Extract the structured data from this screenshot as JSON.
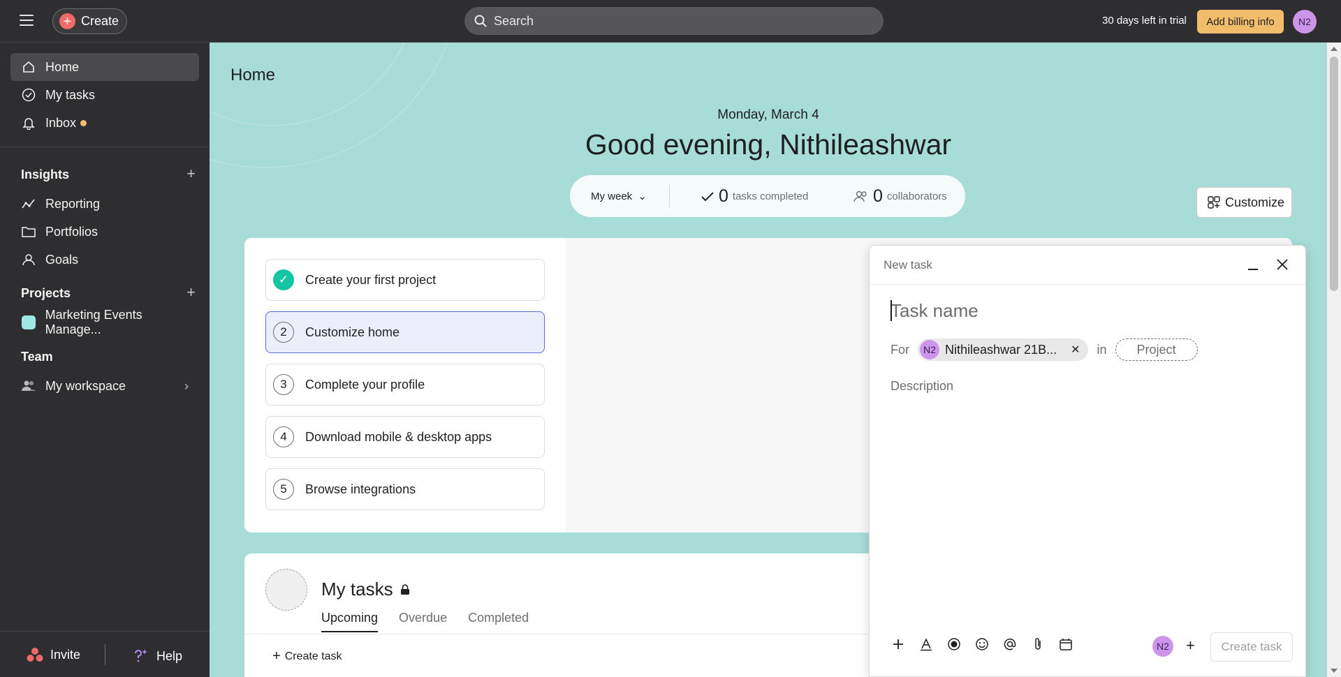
{
  "topbar": {
    "create_label": "Create",
    "search_placeholder": "Search",
    "trial_text": "30 days left in trial",
    "billing_label": "Add billing info",
    "user_initials": "N2"
  },
  "sidebar": {
    "nav": [
      {
        "label": "Home",
        "icon": "home-icon"
      },
      {
        "label": "My tasks",
        "icon": "check-circle-icon"
      },
      {
        "label": "Inbox",
        "icon": "bell-icon"
      }
    ],
    "insights": {
      "title": "Insights",
      "items": [
        {
          "label": "Reporting",
          "icon": "chart-line-icon"
        },
        {
          "label": "Portfolios",
          "icon": "folder-icon"
        },
        {
          "label": "Goals",
          "icon": "person-icon"
        }
      ]
    },
    "projects": {
      "title": "Projects",
      "items": [
        {
          "label": "Marketing Events Manage...",
          "color": "#9ee7e3"
        }
      ]
    },
    "team": {
      "title": "Team",
      "items": [
        {
          "label": "My workspace",
          "icon": "people-icon"
        }
      ]
    },
    "invite_label": "Invite",
    "help_label": "Help"
  },
  "home": {
    "title": "Home",
    "date": "Monday, March 4",
    "greeting": "Good evening, Nithileashwar",
    "stats": {
      "period": "My week",
      "tasks_completed_count": "0",
      "tasks_completed_label": "tasks completed",
      "collaborators_count": "0",
      "collaborators_label": "collaborators"
    },
    "customize_label": "Customize"
  },
  "onboarding": {
    "steps": [
      {
        "num": "✓",
        "label": "Create your first project",
        "done": true
      },
      {
        "num": "2",
        "label": "Customize home",
        "active": true
      },
      {
        "num": "3",
        "label": "Complete your profile"
      },
      {
        "num": "4",
        "label": "Download mobile & desktop apps"
      },
      {
        "num": "5",
        "label": "Browse integrations"
      }
    ]
  },
  "my_tasks": {
    "title": "My tasks",
    "tabs": [
      "Upcoming",
      "Overdue",
      "Completed"
    ],
    "create_task_label": "Create task"
  },
  "new_task": {
    "header": "New task",
    "task_name_placeholder": "Task name",
    "for_label": "For",
    "assignee_initials": "N2",
    "assignee_name": "Nithileashwar 21B...",
    "in_label": "in",
    "project_placeholder": "Project",
    "description_placeholder": "Description",
    "footer_initials": "N2",
    "create_button_label": "Create task"
  },
  "colors": {
    "accent_red": "#f06a6a",
    "billing_yellow": "#f1bd6c",
    "main_bg": "#a8dcd6",
    "check_green": "#14c4a2"
  }
}
